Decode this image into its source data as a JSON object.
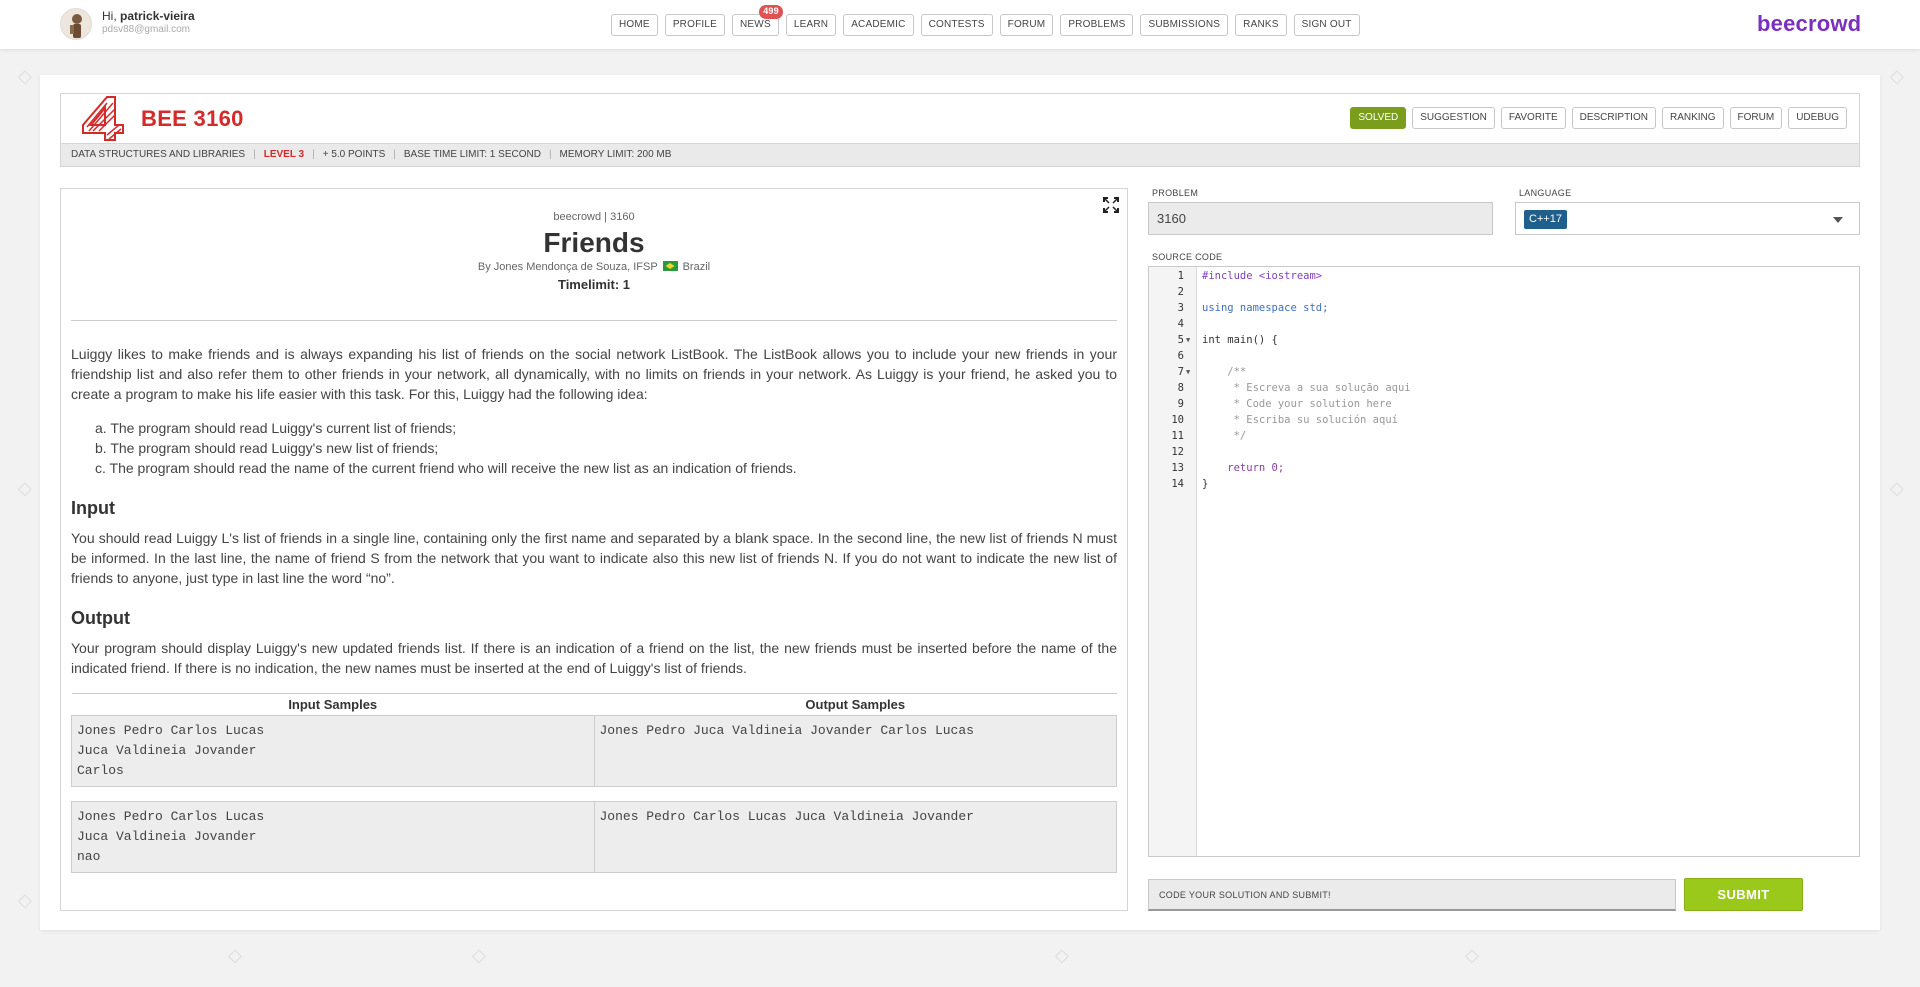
{
  "topbar": {
    "greeting_prefix": "Hi,",
    "username": "patrick-vieira",
    "email": "pdsv88@gmail.com",
    "nav": [
      "HOME",
      "PROFILE",
      "NEWS",
      "LEARN",
      "ACADEMIC",
      "CONTESTS",
      "FORUM",
      "PROBLEMS",
      "SUBMISSIONS",
      "RANKS",
      "SIGN OUT"
    ],
    "news_badge": "499",
    "brand": "beecrowd"
  },
  "problem": {
    "code": "BEE 3160",
    "actions": [
      "SOLVED",
      "SUGGESTION",
      "FAVORITE",
      "DESCRIPTION",
      "RANKING",
      "FORUM",
      "UDEBUG"
    ],
    "meta": {
      "category": "DATA STRUCTURES AND LIBRARIES",
      "level": "LEVEL 3",
      "points": "+ 5.0 POINTS",
      "time_limit": "BASE TIME LIMIT: 1 SECOND",
      "memory_limit": "MEMORY LIMIT: 200 MB"
    }
  },
  "description": {
    "origin": "beecrowd | 3160",
    "title": "Friends",
    "author": "By Jones Mendonça de Souza, IFSP",
    "country": "Brazil",
    "timelimit": "Timelimit: 1",
    "intro": "Luiggy likes to make friends and is always expanding his list of friends on the social network ListBook. The ListBook allows you to include your new friends in your friendship list and also refer them to other friends in your network, all dynamically, with no limits on friends in your network. As Luiggy is your friend, he asked you to create a program to make his life easier with this task. For this, Luiggy had the following idea:",
    "list": [
      "a. The program should read Luiggy's current list of friends;",
      "b. The program should read Luiggy's new list of friends;",
      "c. The program should read the name of the current friend who will receive the new list as an indication of friends."
    ],
    "input_heading": "Input",
    "input_text": "You should read Luiggy L's list of friends in a single line, containing only the first name and separated by a blank space. In the second line, the new list of friends N must be informed. In the last line, the name of friend S from the network that you want to indicate also this new list of friends N. If you do not want to indicate the new list of friends to anyone, just type in last line the word “no”.",
    "output_heading": "Output",
    "output_text": "Your program should display Luiggy's new updated friends list. If there is an indication of a friend on the list, the new friends must be inserted before the name of the indicated friend. If there is no indication, the new names must be inserted at the end of Luiggy's list of friends.",
    "samples": {
      "input_header": "Input Samples",
      "output_header": "Output Samples",
      "rows": [
        {
          "input": "Jones Pedro Carlos Lucas\nJuca Valdineia Jovander\nCarlos",
          "output": "Jones Pedro Juca Valdineia Jovander Carlos Lucas"
        },
        {
          "input": "Jones Pedro Carlos Lucas\nJuca Valdineia Jovander\nnao",
          "output": "Jones Pedro Carlos Lucas Juca Valdineia Jovander"
        }
      ]
    }
  },
  "editor_panel": {
    "problem_label": "PROBLEM",
    "problem_value": "3160",
    "language_label": "LANGUAGE",
    "language_value": "C++17",
    "source_label": "SOURCE CODE",
    "code": [
      "#include <iostream>",
      "",
      "using namespace std;",
      "",
      "int main() {",
      "",
      "    /**",
      "     * Escreva a sua solução aqui",
      "     * Code your solution here",
      "     * Escriba su solución aquí",
      "     */",
      "",
      "    return 0;",
      "}"
    ],
    "submit_message": "CODE YOUR SOLUTION AND SUBMIT!",
    "submit_label": "SUBMIT"
  },
  "colors": {
    "brand": "#7b2fbe",
    "problem_code": "#d42a2a",
    "solved": "#7a9e1c",
    "submit": "#9bc91b",
    "language_tag": "#1f5f8b"
  }
}
